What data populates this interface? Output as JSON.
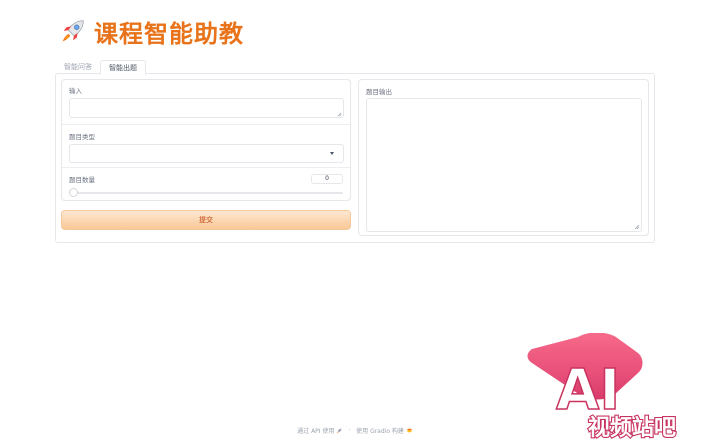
{
  "header": {
    "title": "课程智能助教",
    "icon": "rocket-icon"
  },
  "tabs": [
    {
      "label": "智能问答",
      "active": false
    },
    {
      "label": "智能出题",
      "active": true
    }
  ],
  "form": {
    "input_label": "输入",
    "input_value": "",
    "type_label": "题目类型",
    "type_value": "",
    "count_label": "题目数量",
    "count_value": "0",
    "count_slider_fraction": 0,
    "submit_label": "提交"
  },
  "output": {
    "label": "题目输出",
    "value": ""
  },
  "footer": {
    "api_text": "通过 API 使用",
    "separator": "·",
    "built_text": "使用 Gradio 构建"
  },
  "watermark": {
    "line1": "AI",
    "line2": "视频站吧"
  },
  "colors": {
    "accent": "#e8731a",
    "button_start": "#fde7d2",
    "button_end": "#f9c896",
    "border": "#e5e7eb"
  }
}
